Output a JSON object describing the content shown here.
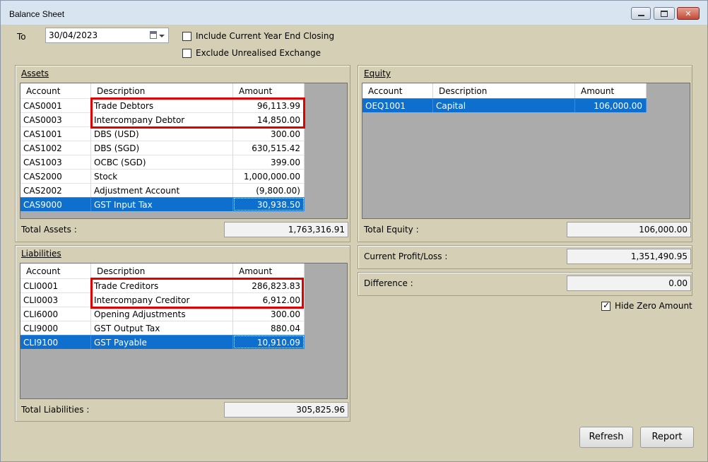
{
  "window": {
    "title": "Balance Sheet"
  },
  "filters": {
    "to_label": "To",
    "date_value": "30/04/2023",
    "include_ye_label": "Include Current Year End Closing",
    "include_ye_checked": false,
    "exclude_ue_label": "Exclude Unrealised Exchange",
    "exclude_ue_checked": false
  },
  "assets": {
    "title": "Assets",
    "headers": [
      "Account",
      "Description",
      "Amount"
    ],
    "rows": [
      {
        "account": "CAS0001",
        "description": "Trade Debtors",
        "amount": "96,113.99"
      },
      {
        "account": "CAS0003",
        "description": "Intercompany Debtor",
        "amount": "14,850.00"
      },
      {
        "account": "CAS1001",
        "description": "DBS (USD)",
        "amount": "300.00"
      },
      {
        "account": "CAS1002",
        "description": "DBS (SGD)",
        "amount": "630,515.42"
      },
      {
        "account": "CAS1003",
        "description": "OCBC (SGD)",
        "amount": "399.00"
      },
      {
        "account": "CAS2000",
        "description": "Stock",
        "amount": "1,000,000.00"
      },
      {
        "account": "CAS2002",
        "description": "Adjustment Account",
        "amount": "(9,800.00)"
      },
      {
        "account": "CAS9000",
        "description": "GST Input Tax",
        "amount": "30,938.50"
      }
    ],
    "selected_row": 7,
    "total_label": "Total Assets :",
    "total_value": "1,763,316.91"
  },
  "liabilities": {
    "title": "Liabilities",
    "headers": [
      "Account",
      "Description",
      "Amount"
    ],
    "rows": [
      {
        "account": "CLI0001",
        "description": "Trade Creditors",
        "amount": "286,823.83"
      },
      {
        "account": "CLI0003",
        "description": "Intercompany Creditor",
        "amount": "6,912.00"
      },
      {
        "account": "CLI6000",
        "description": "Opening Adjustments",
        "amount": "300.00"
      },
      {
        "account": "CLI9000",
        "description": "GST Output Tax",
        "amount": "880.04"
      },
      {
        "account": "CLI9100",
        "description": "GST Payable",
        "amount": "10,910.09"
      }
    ],
    "selected_row": 4,
    "total_label": "Total Liabilities :",
    "total_value": "305,825.96"
  },
  "equity": {
    "title": "Equity",
    "headers": [
      "Account",
      "Description",
      "Amount"
    ],
    "rows": [
      {
        "account": "OEQ1001",
        "description": "Capital",
        "amount": "106,000.00"
      }
    ],
    "selected_row": 0,
    "total_label": "Total Equity :",
    "total_value": "106,000.00"
  },
  "summary": {
    "profit_label": "Current Profit/Loss :",
    "profit_value": "1,351,490.95",
    "difference_label": "Difference :",
    "difference_value": "0.00",
    "hide_zero_label": "Hide Zero Amount",
    "hide_zero_checked": true
  },
  "buttons": {
    "refresh": "Refresh",
    "report": "Report"
  },
  "colors": {
    "selection": "#0f6fcf",
    "highlight_box": "#e00000",
    "window_bg": "#d5cfb5"
  }
}
